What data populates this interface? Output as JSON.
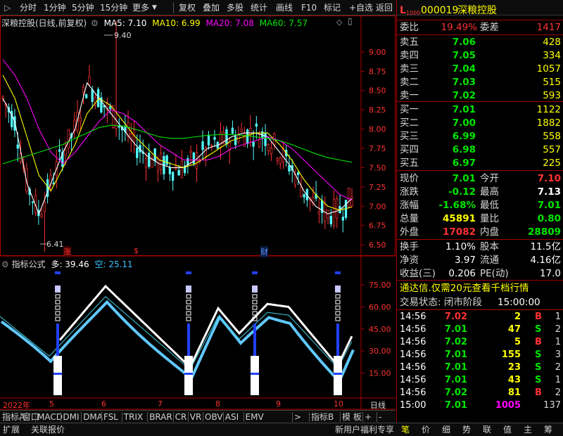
{
  "toolbar": {
    "left_items": [
      "分时",
      "1分钟",
      "5分钟",
      "15分钟",
      "更多"
    ],
    "right_items": [
      "复权",
      "叠加",
      "多股",
      "统计",
      "画线",
      "F10",
      "标记",
      "+自选",
      "返回"
    ]
  },
  "main_chart": {
    "stock_title": "深粮控股(日线,前复权)",
    "ma_labels": [
      {
        "text": "MA5: 7.10",
        "color": "#ffffff"
      },
      {
        "text": "MA10: 6.99",
        "color": "#ffff00"
      },
      {
        "text": "MA20: 7.08",
        "color": "#ff00ff"
      },
      {
        "text": "MA60: 7.57",
        "color": "#00e600"
      }
    ],
    "y_ticks": [
      "9.00",
      "8.75",
      "8.50",
      "8.25",
      "8.00",
      "7.75",
      "7.50",
      "7.25",
      "7.00",
      "6.75",
      "6.50"
    ],
    "high_label": "9.40",
    "low_label": "6.41",
    "markers": [
      "涨",
      "$",
      "财"
    ]
  },
  "indicator": {
    "title": "指标公式",
    "long_label": "多: 39.46",
    "short_label": "空: 25.11",
    "y_ticks": [
      "75.00",
      "60.00",
      "45.00",
      "30.00",
      "15.00"
    ]
  },
  "x_axis": {
    "labels": [
      "2022年",
      "5",
      "6",
      "7",
      "8",
      "9",
      "10"
    ],
    "right_label": "日线"
  },
  "bottom_tabs": [
    "指标A",
    "窗口",
    "MACD",
    "DMI",
    "DMA",
    "FSL",
    "TRIX",
    "BRAR",
    "CR",
    "VR",
    "OBV",
    "ASI",
    "EMV",
    ">",
    "指标B",
    "模 板",
    "+",
    "-"
  ],
  "status_bar": {
    "left": [
      "扩展",
      "关联报价"
    ],
    "promo": "新用户福利专享",
    "tabs": [
      "笔",
      "价",
      "细",
      "势",
      "联",
      "值",
      "主",
      "筹"
    ]
  },
  "quote_panel": {
    "code": "000019",
    "name": "深粮控股",
    "webi_label": "委比",
    "webi_value": "19.49%",
    "weicha_label": "委差",
    "weicha_value": "1417",
    "sell": [
      {
        "label": "卖五",
        "price": "7.06",
        "vol": "428"
      },
      {
        "label": "卖四",
        "price": "7.05",
        "vol": "334"
      },
      {
        "label": "卖三",
        "price": "7.04",
        "vol": "1057"
      },
      {
        "label": "卖二",
        "price": "7.03",
        "vol": "515"
      },
      {
        "label": "卖一",
        "price": "7.02",
        "vol": "593"
      }
    ],
    "buy": [
      {
        "label": "买一",
        "price": "7.01",
        "vol": "1122"
      },
      {
        "label": "买二",
        "price": "7.00",
        "vol": "1882"
      },
      {
        "label": "买三",
        "price": "6.99",
        "vol": "558"
      },
      {
        "label": "买四",
        "price": "6.98",
        "vol": "557"
      },
      {
        "label": "买五",
        "price": "6.97",
        "vol": "225"
      }
    ],
    "stats": [
      {
        "l1": "现价",
        "v1": "7.01",
        "c1": "#00e600",
        "l2": "今开",
        "v2": "7.10",
        "c2": "#ff3232"
      },
      {
        "l1": "涨跌",
        "v1": "-0.12",
        "c1": "#00e600",
        "l2": "最高",
        "v2": "7.13",
        "c2": "#ffffff"
      },
      {
        "l1": "涨幅",
        "v1": "-1.68%",
        "c1": "#00e600",
        "l2": "最低",
        "v2": "7.01",
        "c2": "#00e600"
      },
      {
        "l1": "总量",
        "v1": "45891",
        "c1": "#ffff00",
        "l2": "量比",
        "v2": "0.80",
        "c2": "#00e600"
      },
      {
        "l1": "外盘",
        "v1": "17082",
        "c1": "#ff3232",
        "l2": "内盘",
        "v2": "28809",
        "c2": "#00e600"
      }
    ],
    "finance": [
      {
        "l1": "换手",
        "v1": "1.10%",
        "l2": "股本",
        "v2": "11.5亿"
      },
      {
        "l1": "净资",
        "v1": "3.97",
        "l2": "流通",
        "v2": "4.16亿"
      },
      {
        "l1": "收益(三)",
        "v1": "0.206",
        "l2": "PE(动)",
        "v2": "17.0"
      }
    ],
    "promo": "通达信.仅需20元查看千档行情",
    "trade_state_label": "交易状态: 闭市阶段",
    "trade_state_time": "15:00:00",
    "ticks": [
      {
        "time": "14:56",
        "price": "7.02",
        "pc": "#ff3232",
        "vol": "2",
        "vc": "#ffff00",
        "bs": "B",
        "bc": "#ff3232",
        "n": "1"
      },
      {
        "time": "14:56",
        "price": "7.01",
        "pc": "#00e600",
        "vol": "47",
        "vc": "#ffff00",
        "bs": "S",
        "bc": "#00e600",
        "n": "2"
      },
      {
        "time": "14:56",
        "price": "7.02",
        "pc": "#00e600",
        "vol": "5",
        "vc": "#ffff00",
        "bs": "B",
        "bc": "#ff3232",
        "n": "1"
      },
      {
        "time": "14:56",
        "price": "7.01",
        "pc": "#00e600",
        "vol": "155",
        "vc": "#ffff00",
        "bs": "S",
        "bc": "#00e600",
        "n": "3"
      },
      {
        "time": "14:56",
        "price": "7.01",
        "pc": "#00e600",
        "vol": "23",
        "vc": "#ffff00",
        "bs": "S",
        "bc": "#00e600",
        "n": "2"
      },
      {
        "time": "14:56",
        "price": "7.01",
        "pc": "#00e600",
        "vol": "43",
        "vc": "#ffff00",
        "bs": "S",
        "bc": "#00e600",
        "n": "1"
      },
      {
        "time": "14:56",
        "price": "7.02",
        "pc": "#00e600",
        "vol": "81",
        "vc": "#ffff00",
        "bs": "B",
        "bc": "#ff3232",
        "n": "2"
      },
      {
        "time": "15:00",
        "price": "7.01",
        "pc": "#00e600",
        "vol": "1005",
        "vc": "#ff00ff",
        "bs": "",
        "bc": "#ffffff",
        "n": "137"
      }
    ]
  },
  "chart_data": {
    "type": "line",
    "title": "深粮控股(日线,前复权)",
    "xlabel": "",
    "ylabel": "",
    "ylim": [
      6.41,
      9.4
    ],
    "x": [
      "2022年",
      "5",
      "6",
      "7",
      "8",
      "9",
      "10"
    ],
    "series": [
      {
        "name": "MA5",
        "values": [
          8.4,
          8.1,
          7.3,
          6.9,
          7.3,
          7.7,
          8.0,
          8.6,
          8.4,
          8.2,
          8.0,
          7.8,
          7.65,
          7.55,
          7.5,
          7.5,
          7.6,
          7.75,
          7.8,
          7.9,
          7.95,
          7.95,
          7.9,
          7.7,
          7.5,
          7.2,
          7.0,
          6.9,
          6.95,
          7.1
        ]
      },
      {
        "name": "MA10",
        "values": [
          8.7,
          8.4,
          7.9,
          7.4,
          7.2,
          7.5,
          7.8,
          8.2,
          8.4,
          8.3,
          8.1,
          7.9,
          7.75,
          7.6,
          7.55,
          7.5,
          7.55,
          7.65,
          7.75,
          7.85,
          7.9,
          7.95,
          7.95,
          7.8,
          7.6,
          7.35,
          7.15,
          7.0,
          6.95,
          6.99
        ]
      },
      {
        "name": "MA20",
        "values": [
          8.9,
          8.7,
          8.4,
          8.0,
          7.7,
          7.55,
          7.7,
          7.9,
          8.1,
          8.25,
          8.2,
          8.1,
          7.95,
          7.8,
          7.7,
          7.6,
          7.6,
          7.6,
          7.65,
          7.75,
          7.8,
          7.85,
          7.9,
          7.85,
          7.75,
          7.6,
          7.45,
          7.3,
          7.15,
          7.08
        ]
      },
      {
        "name": "MA60",
        "values": [
          7.55,
          7.6,
          7.65,
          7.7,
          7.75,
          7.8,
          7.88,
          7.95,
          8.02,
          8.05,
          8.04,
          8.0,
          7.95,
          7.9,
          7.88,
          7.88,
          7.9,
          7.92,
          7.93,
          7.93,
          7.92,
          7.9,
          7.88,
          7.85,
          7.8,
          7.74,
          7.68,
          7.63,
          7.6,
          7.57
        ]
      }
    ]
  }
}
